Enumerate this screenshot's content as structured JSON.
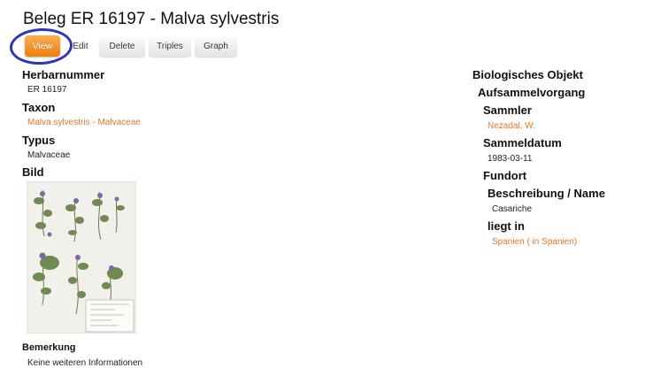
{
  "page": {
    "title": "Beleg ER 16197 - Malva sylvestris"
  },
  "tabs": [
    {
      "label": "View",
      "active": true
    },
    {
      "label": "Edit",
      "active": false
    },
    {
      "label": "Delete",
      "active": false
    },
    {
      "label": "Triples",
      "active": false
    },
    {
      "label": "Graph",
      "active": false
    }
  ],
  "colors": {
    "accent": "#ee7c14",
    "link": "#e0782a",
    "highlight_ring": "#2b37b8"
  },
  "left": {
    "herbarnummer": {
      "label": "Herbarnummer",
      "value": "ER 16197"
    },
    "taxon": {
      "label": "Taxon",
      "value": "Malva sylvestris - Malvaceae"
    },
    "typus": {
      "label": "Typus",
      "value": "Malvaceae"
    },
    "bild": {
      "label": "Bild"
    },
    "bemerkung": {
      "label": "Bemerkung",
      "value": "Keine weiteren Informationen"
    }
  },
  "right": {
    "biologisches_objekt": {
      "label": "Biologisches Objekt"
    },
    "aufsammelvorgang": {
      "label": "Aufsammelvorgang"
    },
    "sammler": {
      "label": "Sammler",
      "value": "Nezadal, W."
    },
    "sammeldatum": {
      "label": "Sammeldatum",
      "value": "1983-03-11"
    },
    "fundort": {
      "label": "Fundort"
    },
    "beschreibung": {
      "label": "Beschreibung / Name",
      "value": "Casariche"
    },
    "liegt_in": {
      "label": "liegt in",
      "value": "Spanien ( in Spanien)"
    }
  }
}
